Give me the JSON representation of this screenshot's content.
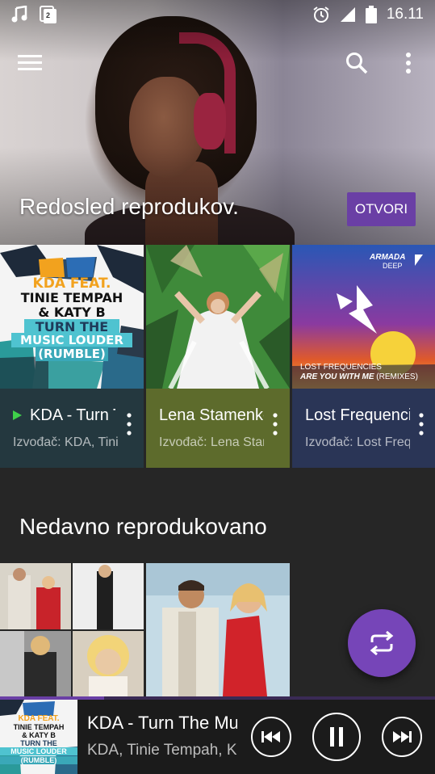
{
  "status_bar": {
    "time": "16.11",
    "notification_badge": "2",
    "icons": [
      "music-note-icon",
      "photo-badge-icon",
      "alarm-icon",
      "signal-icon",
      "battery-icon"
    ]
  },
  "app_bar": {
    "menu_icon": "hamburger-menu-icon",
    "search_icon": "search-icon",
    "more_icon": "more-vert-icon"
  },
  "hero": {
    "title": "Redosled reprodukov.",
    "button_label": "OTVORI"
  },
  "cards": [
    {
      "title": "KDA - Turn The Music Louder",
      "subtitle": "Izvođač: KDA, Tinie Tempah, Katy B",
      "playing": true,
      "color": "#24383f",
      "art_lines": [
        "KDA FEAT.",
        "TINIE TEMPAH",
        "& KATY B",
        "TURN THE",
        "MUSIC LOUDER",
        "(RUMBLE)"
      ]
    },
    {
      "title": "Lena Stamenković",
      "subtitle": "Izvođač: Lena Stamenković",
      "playing": false,
      "color": "#5d6b2c"
    },
    {
      "title": "Lost Frequencies",
      "subtitle": "Izvođač: Lost Frequencies",
      "playing": false,
      "color": "#2a3556",
      "art_lines": [
        "ARMADA",
        "DEEP",
        "LOST FREQUENCIES",
        "ARE YOU WITH ME",
        "(REMIXES)"
      ]
    }
  ],
  "recent_section": {
    "title": "Nedavno reprodukovano"
  },
  "fab": {
    "icon": "repeat-icon"
  },
  "player": {
    "title": "KDA - Turn The Music Louder",
    "artist": "KDA, Tinie Tempah, Katy B",
    "progress": 0.24,
    "art_lines": [
      "KDA FEAT.",
      "TINIE TEMPAH",
      "& KATY B",
      "TURN THE",
      "MUSIC LOUDER",
      "(RUMBLE)"
    ]
  },
  "colors": {
    "accent": "#6a3fa5",
    "fab": "#7645b8",
    "background": "#262626",
    "playing_indicator": "#3fd04a"
  }
}
